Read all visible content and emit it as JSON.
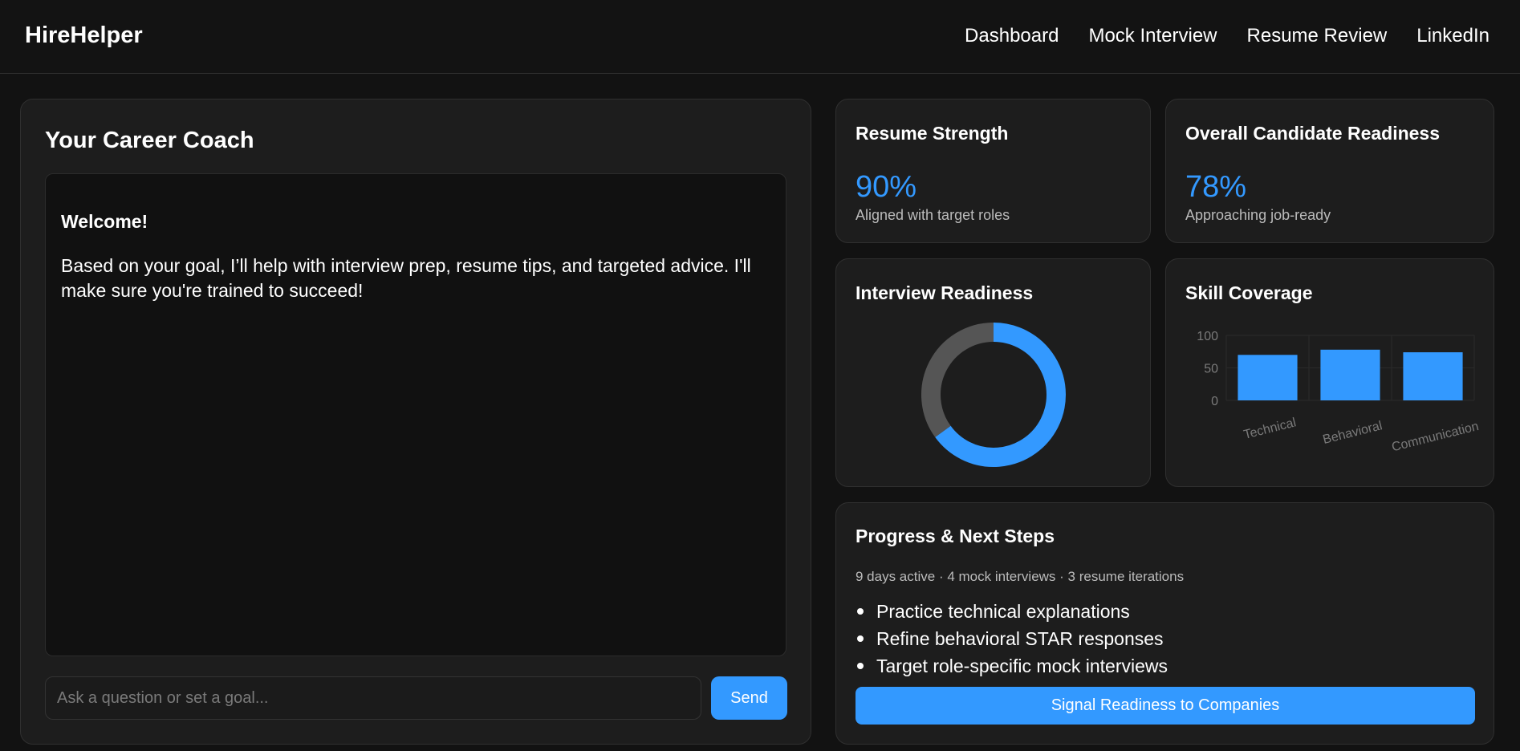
{
  "header": {
    "brand": "HireHelper",
    "nav": [
      "Dashboard",
      "Mock Interview",
      "Resume Review",
      "LinkedIn"
    ]
  },
  "coach": {
    "title": "Your Career Coach",
    "welcome": "Welcome!",
    "message": "Based on your goal, I’ll help with interview prep, resume tips, and targeted advice. I'll make sure you're trained to succeed!",
    "input_placeholder": "Ask a question or set a goal...",
    "send_label": "Send"
  },
  "resume_strength": {
    "title": "Resume Strength",
    "value": "90%",
    "sub": "Aligned with target roles"
  },
  "overall_readiness": {
    "title": "Overall Candidate Readiness",
    "value": "78%",
    "sub": "Approaching job-ready"
  },
  "interview_readiness": {
    "title": "Interview Readiness"
  },
  "skill_coverage": {
    "title": "Skill Coverage"
  },
  "progress": {
    "title": "Progress & Next Steps",
    "stats": "9 days active · 4 mock interviews · 3 resume iterations",
    "steps": [
      "Practice technical explanations",
      "Refine behavioral STAR responses",
      "Target role-specific mock interviews"
    ],
    "cta_label": "Signal Readiness to Companies"
  },
  "colors": {
    "accent": "#3399ff",
    "track": "#555555"
  },
  "chart_data": [
    {
      "type": "pie",
      "variant": "doughnut",
      "values": [
        65,
        35
      ],
      "colors": [
        "#3399ff",
        "#555555"
      ]
    },
    {
      "type": "bar",
      "categories": [
        "Technical",
        "Behavioral",
        "Communication"
      ],
      "values": [
        70,
        78,
        74
      ],
      "ylim": [
        0,
        100
      ],
      "yticks": [
        0,
        50,
        100
      ],
      "grid": true,
      "color": "#3399ff"
    }
  ]
}
